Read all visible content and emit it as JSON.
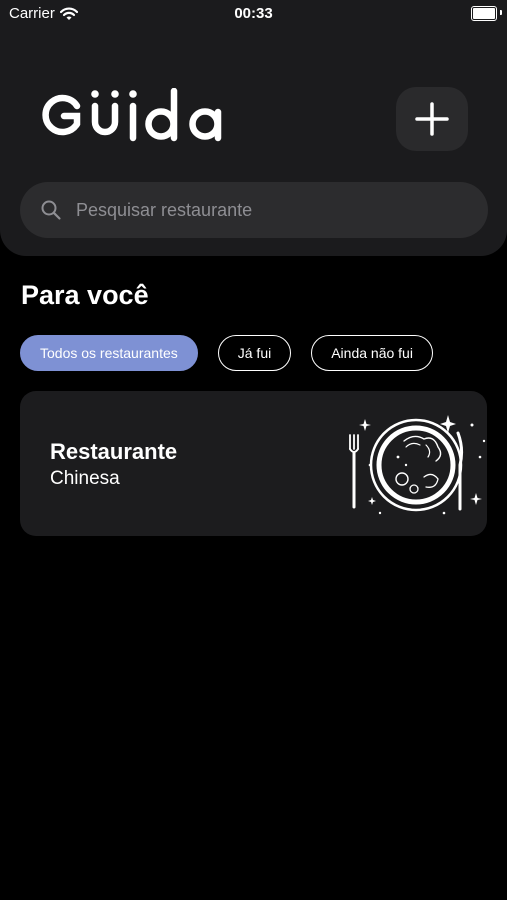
{
  "status_bar": {
    "carrier": "Carrier",
    "time": "00:33"
  },
  "header": {
    "logo_text": "Güida",
    "add_button_icon": "plus-icon"
  },
  "search": {
    "placeholder": "Pesquisar restaurante",
    "value": "",
    "icon": "search-icon"
  },
  "section": {
    "title": "Para você"
  },
  "filters": [
    {
      "label": "Todos os restaurantes",
      "active": true
    },
    {
      "label": "Já fui",
      "active": false
    },
    {
      "label": "Ainda não fui",
      "active": false
    }
  ],
  "restaurants": [
    {
      "name": "Restaurante",
      "cuisine": "Chinesa",
      "icon": "plate-cutlery-icon"
    }
  ],
  "colors": {
    "background": "#000000",
    "header_panel": "#1b1b1d",
    "card": "#1c1c1e",
    "search_bar": "#2c2c2e",
    "accent": "#7e91d4",
    "placeholder": "#8e8e93",
    "text": "#ffffff"
  }
}
